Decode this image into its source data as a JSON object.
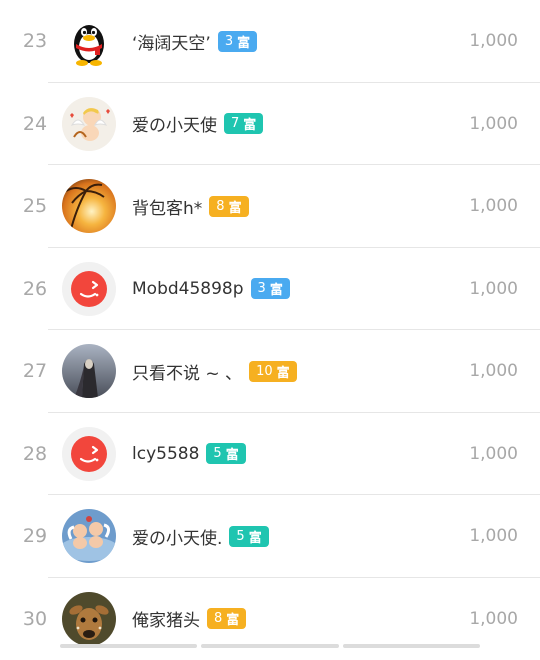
{
  "rows": [
    {
      "rank": "23",
      "name": "‘海阔天空’",
      "level": "3",
      "badge": "富",
      "badge_color": "#4aaaf0",
      "score": "1,000",
      "avatar": "qq-penguin-avatar"
    },
    {
      "rank": "24",
      "name": "爱の小天使",
      "level": "7",
      "badge": "富",
      "badge_color": "#1fc5b0",
      "score": "1,000",
      "avatar": "cupid-avatar"
    },
    {
      "rank": "25",
      "name": "背包客h*",
      "level": "8",
      "badge": "富",
      "badge_color": "#f6b021",
      "score": "1,000",
      "avatar": "sunset-palm-avatar"
    },
    {
      "rank": "26",
      "name": "Mobd45898p",
      "level": "3",
      "badge": "富",
      "badge_color": "#4aaaf0",
      "score": "1,000",
      "avatar": "red-wink-avatar"
    },
    {
      "rank": "27",
      "name": "只看不说 ~ 、",
      "level": "10",
      "badge": "富",
      "badge_color": "#f6b021",
      "score": "1,000",
      "avatar": "cloaked-figure-avatar"
    },
    {
      "rank": "28",
      "name": "lcy5588",
      "level": "5",
      "badge": "富",
      "badge_color": "#1fc5b0",
      "score": "1,000",
      "avatar": "red-wink-avatar"
    },
    {
      "rank": "29",
      "name": "爱の小天使.",
      "level": "5",
      "badge": "富",
      "badge_color": "#1fc5b0",
      "score": "1,000",
      "avatar": "angels-avatar"
    },
    {
      "rank": "30",
      "name": "俺家猪头",
      "level": "8",
      "badge": "富",
      "badge_color": "#f6b021",
      "score": "1,000",
      "avatar": "deer-avatar"
    }
  ]
}
